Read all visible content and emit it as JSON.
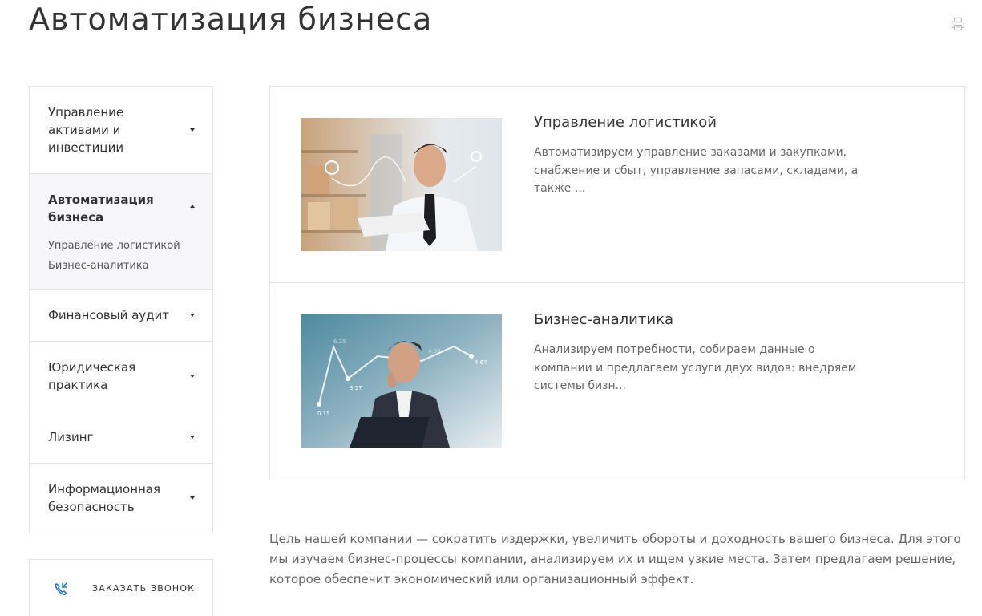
{
  "page": {
    "title": "Автоматизация бизнеса"
  },
  "icons": {
    "print": "printer-icon",
    "callback": "phone-icon",
    "dropdown_closed": "chevron-down-icon",
    "dropdown_open": "chevron-up-icon"
  },
  "sidebar": {
    "items": [
      {
        "label": "Управление активами и инвестиции",
        "expanded": false
      },
      {
        "label": "Автоматизация бизнеса",
        "expanded": true,
        "children": [
          "Управление логистикой",
          "Бизнес-аналитика"
        ]
      },
      {
        "label": "Финансовый аудит",
        "expanded": false
      },
      {
        "label": "Юридическая практика",
        "expanded": false
      },
      {
        "label": "Лизинг",
        "expanded": false
      },
      {
        "label": "Информационная безопасность",
        "expanded": false
      }
    ]
  },
  "callback": {
    "label": "ЗАКАЗАТЬ ЗВОНОК"
  },
  "cards": [
    {
      "title": "Управление логистикой",
      "description": "Автоматизируем управление заказами и закупками, снабжение и сбыт, управление запасами, складами, а также ..."
    },
    {
      "title": "Бизнес-аналитика",
      "description": "Анализируем потребности, собираем данные о компании и предлагаем услуги двух видов: внедряем системы бизн...",
      "image_chart_labels": [
        "0.15",
        "3.17",
        "4.67",
        "6.25",
        "4.28"
      ]
    }
  ],
  "intro": {
    "text": "Цель нашей компании — сократить издержки, увеличить обороты и доходность вашего бизнеса. Для этого мы изучаем бизнес-процессы компании, анализируем их и ищем узкие места. Затем предлагаем решение, которое обеспечит экономический или организационный эффект."
  },
  "colors": {
    "border": "#e5e5e5",
    "active_bg": "#f6f6f8",
    "text": "#333333",
    "muted": "#666666"
  }
}
